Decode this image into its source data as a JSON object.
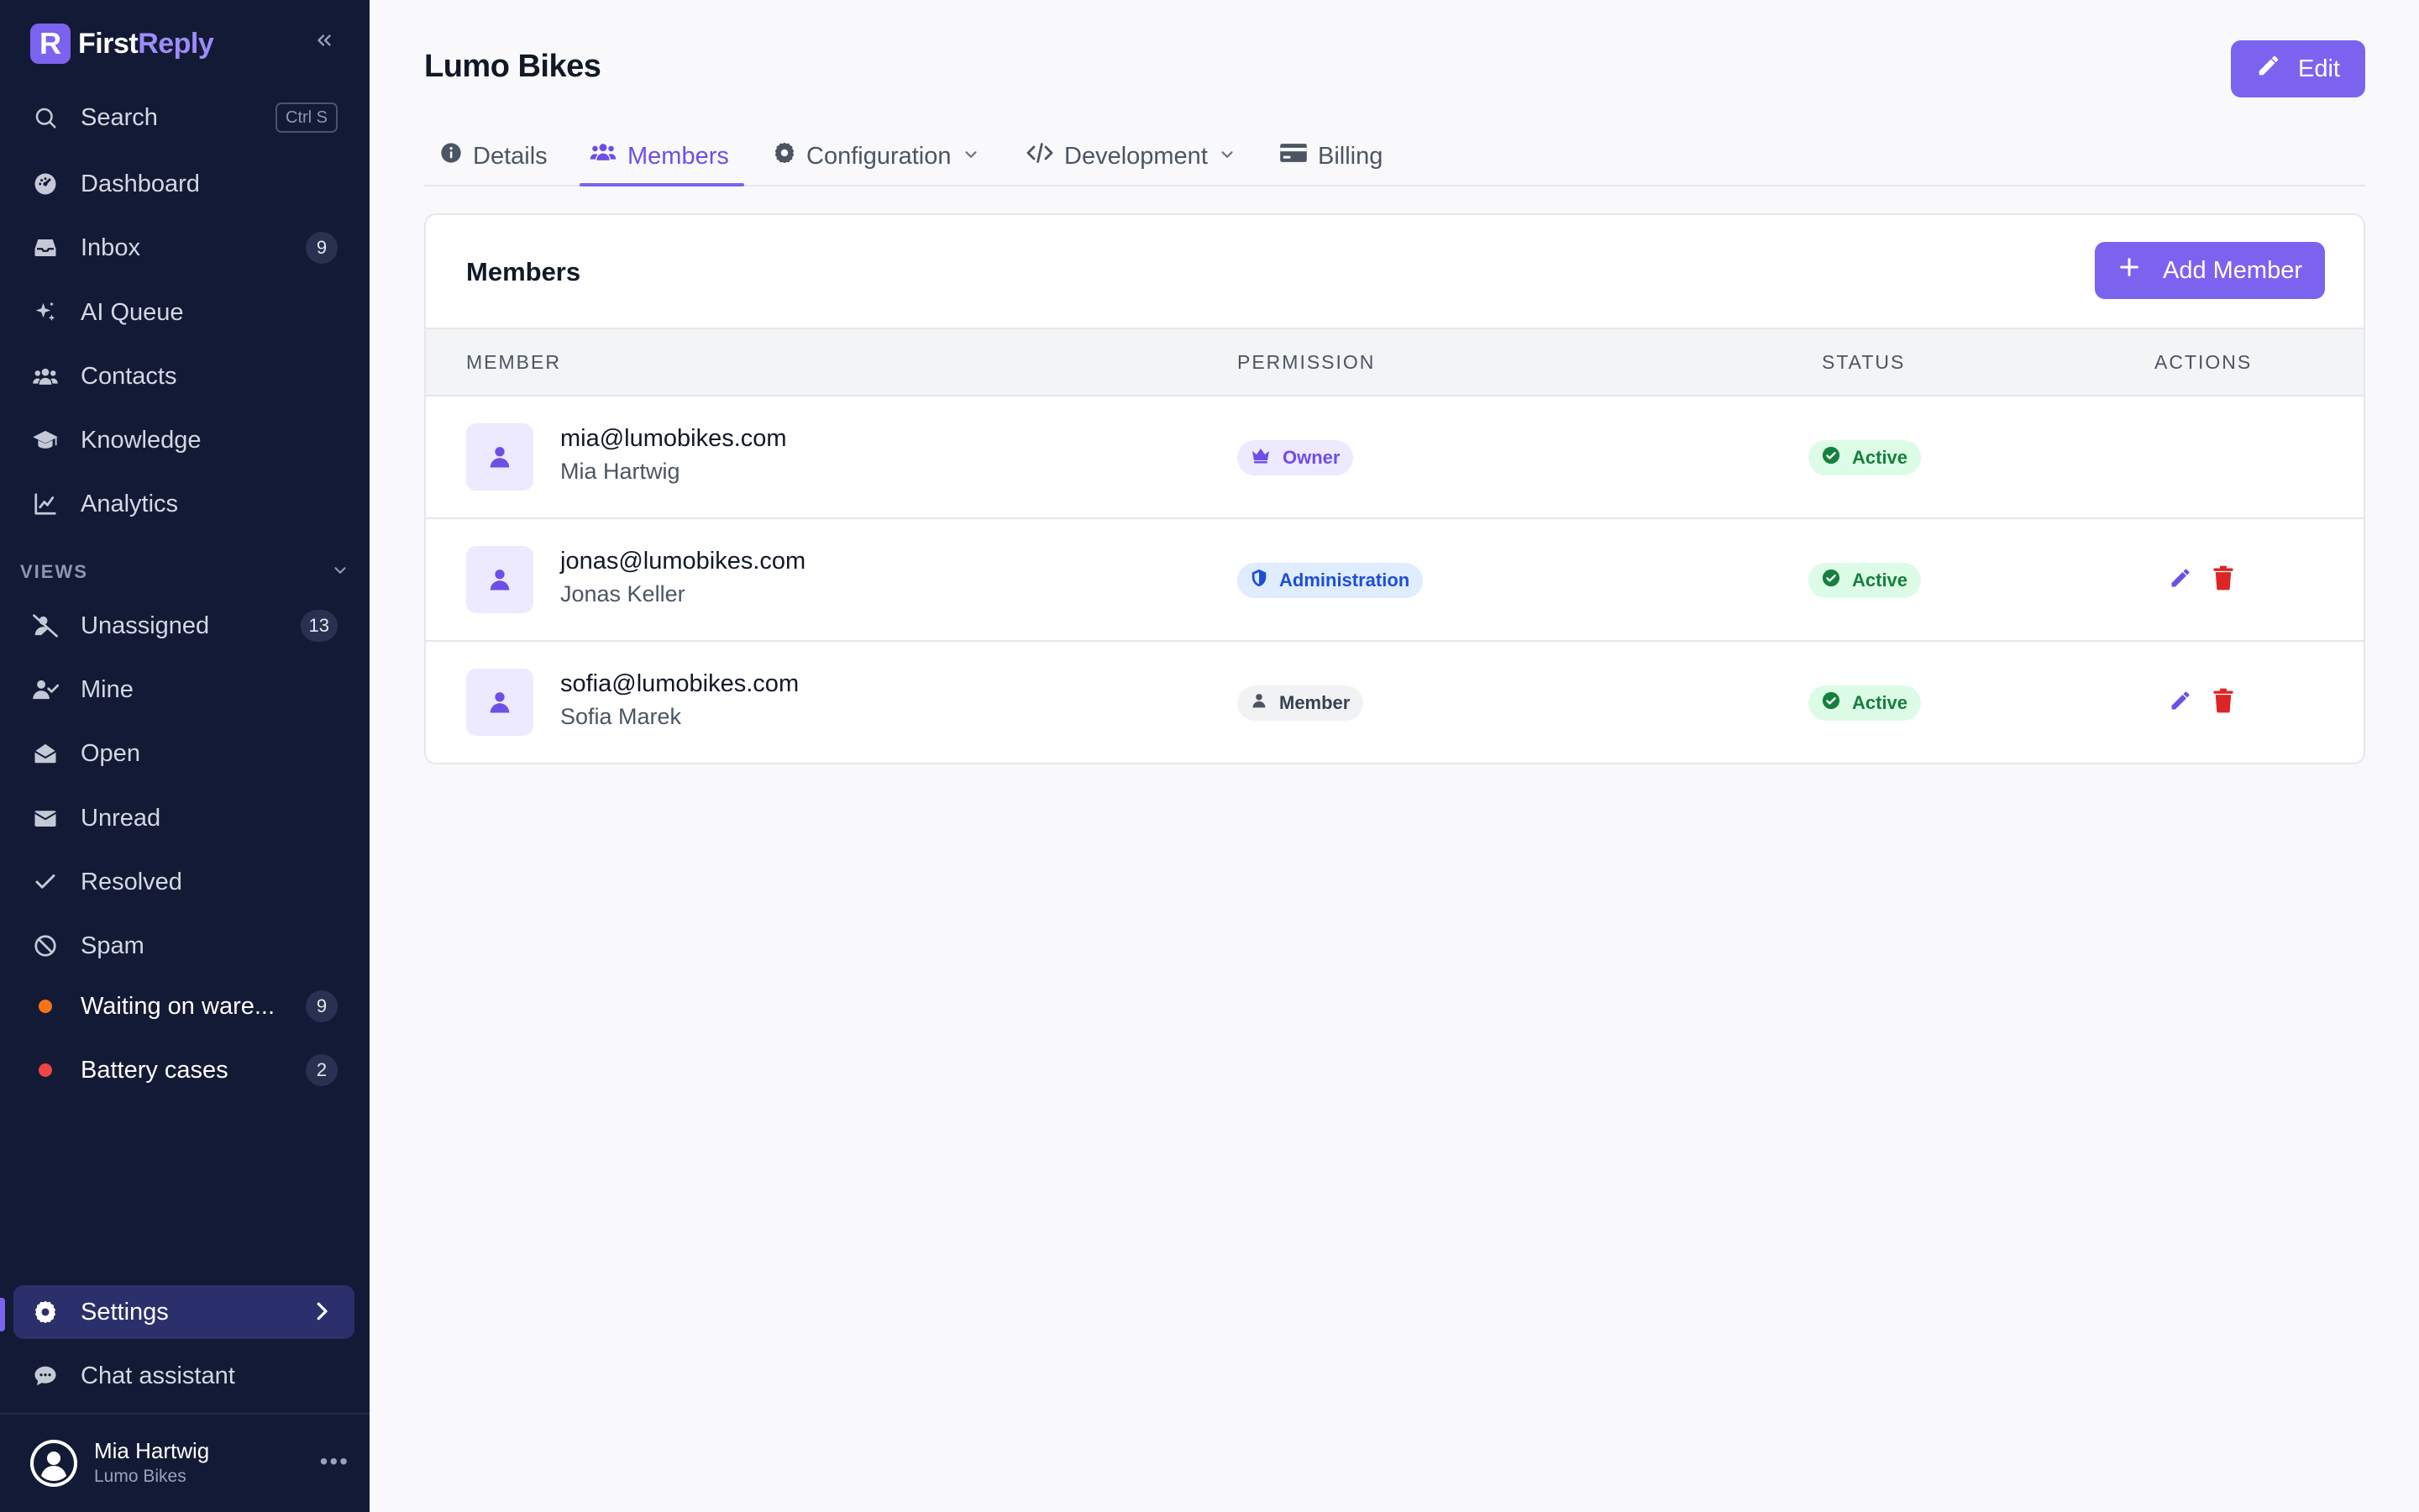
{
  "brand": {
    "logo_letter": "R",
    "name_part1": "First",
    "name_part2": "Reply"
  },
  "sidebar": {
    "search": {
      "label": "Search",
      "shortcut": "Ctrl S"
    },
    "items": [
      {
        "label": "Dashboard",
        "icon": "dashboard-icon"
      },
      {
        "label": "Inbox",
        "icon": "inbox-icon",
        "count": "9"
      },
      {
        "label": "AI Queue",
        "icon": "sparkles-icon"
      },
      {
        "label": "Contacts",
        "icon": "contacts-icon"
      },
      {
        "label": "Knowledge",
        "icon": "graduation-cap-icon"
      },
      {
        "label": "Analytics",
        "icon": "chart-line-icon"
      }
    ],
    "views_header": "VIEWS",
    "views": [
      {
        "label": "Unassigned",
        "icon": "user-slash-icon",
        "count": "13"
      },
      {
        "label": "Mine",
        "icon": "user-check-icon"
      },
      {
        "label": "Open",
        "icon": "envelope-open-icon"
      },
      {
        "label": "Unread",
        "icon": "envelope-icon"
      },
      {
        "label": "Resolved",
        "icon": "check-icon"
      },
      {
        "label": "Spam",
        "icon": "ban-icon"
      },
      {
        "label": "Waiting on ware...",
        "dot_color": "#f97316",
        "count": "9"
      },
      {
        "label": "Battery cases",
        "dot_color": "#ef4444",
        "count": "2"
      }
    ],
    "settings": {
      "label": "Settings"
    },
    "chat_assistant": {
      "label": "Chat assistant"
    },
    "user": {
      "name": "Mia Hartwig",
      "org": "Lumo Bikes",
      "more": "•••"
    }
  },
  "page": {
    "title": "Lumo Bikes",
    "edit_label": "Edit",
    "tabs": [
      {
        "label": "Details"
      },
      {
        "label": "Members"
      },
      {
        "label": "Configuration"
      },
      {
        "label": "Development"
      },
      {
        "label": "Billing"
      }
    ],
    "active_tab": "Members"
  },
  "members_card": {
    "title": "Members",
    "add_label": "Add Member",
    "columns": [
      "MEMBER",
      "PERMISSION",
      "STATUS",
      "ACTIONS"
    ],
    "rows": [
      {
        "email": "mia@lumobikes.com",
        "name": "Mia Hartwig",
        "permission": "Owner",
        "status": "Active",
        "actions": false
      },
      {
        "email": "jonas@lumobikes.com",
        "name": "Jonas Keller",
        "permission": "Administration",
        "status": "Active",
        "actions": true
      },
      {
        "email": "sofia@lumobikes.com",
        "name": "Sofia Marek",
        "permission": "Member",
        "status": "Active",
        "actions": true
      }
    ]
  },
  "colors": {
    "accent": "#7c63ef",
    "sidebar_bg": "#131a35",
    "status_green": "#15803d",
    "delete_red": "#dc2626"
  }
}
